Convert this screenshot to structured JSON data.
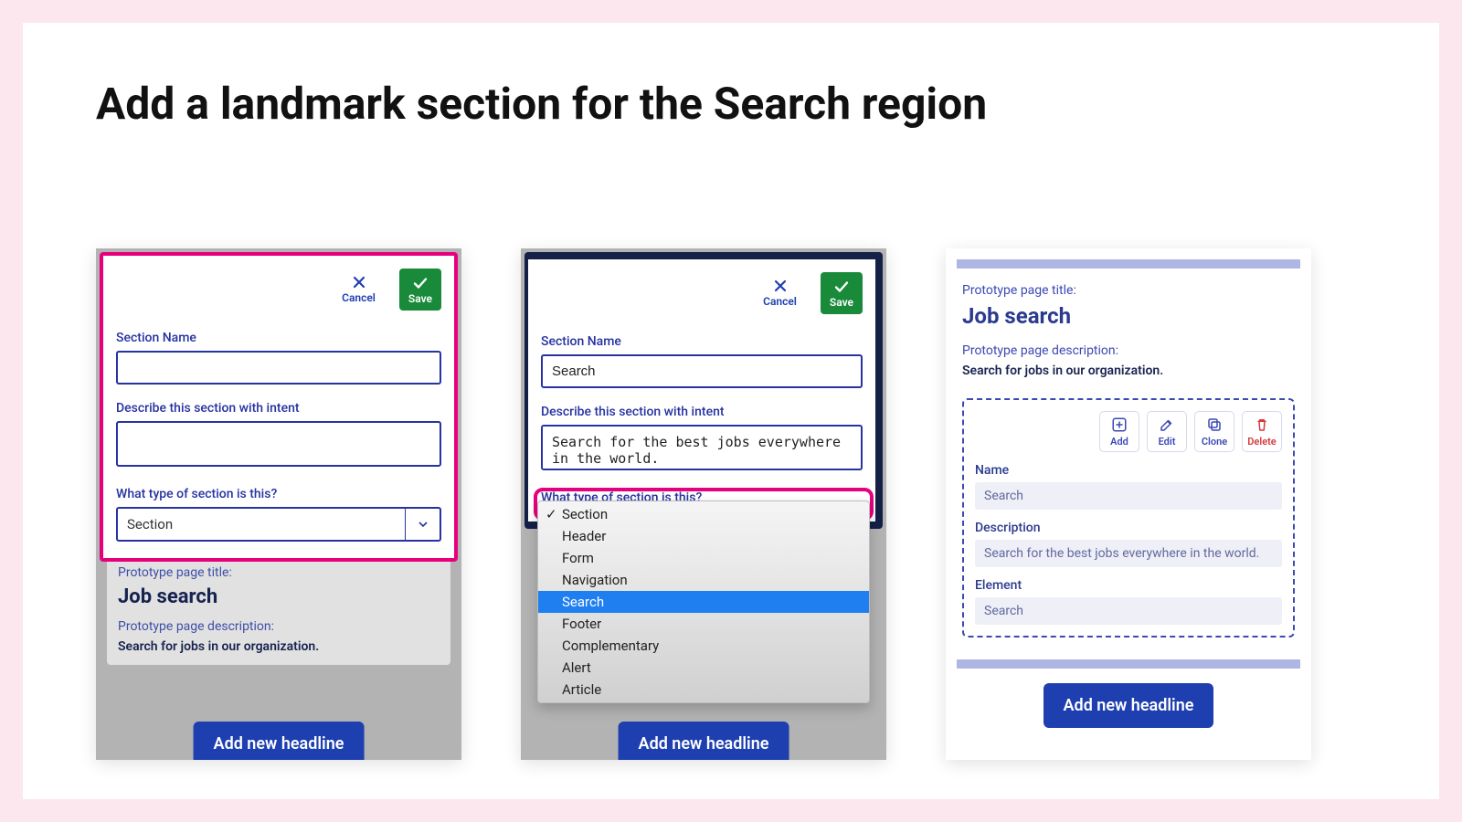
{
  "heading": "Add a landmark section for the Search region",
  "dialog": {
    "cancel_label": "Cancel",
    "save_label": "Save",
    "section_name_label": "Section Name",
    "describe_label": "Describe this section with intent",
    "type_label": "What type of section is this?"
  },
  "panel1": {
    "section_name_value": "",
    "describe_value": "",
    "type_value": "Section"
  },
  "panel2": {
    "section_name_value": "Search",
    "describe_value": "Search for the best jobs everywhere in the world.",
    "type_selected": "Section",
    "type_highlight": "Search",
    "options": [
      "Section",
      "Header",
      "Form",
      "Navigation",
      "Search",
      "Footer",
      "Complementary",
      "Alert",
      "Article"
    ]
  },
  "proto": {
    "title_label": "Prototype page title:",
    "title_value": "Job search",
    "desc_label": "Prototype page description:",
    "desc_value": "Search for jobs in our organization.",
    "add_headline_btn": "Add new headline"
  },
  "panel3": {
    "actions": {
      "add": "Add",
      "edit": "Edit",
      "clone": "Clone",
      "delete": "Delete"
    },
    "name_label": "Name",
    "name_value": "Search",
    "desc_label": "Description",
    "desc_value": "Search for the best jobs everywhere in the world.",
    "element_label": "Element",
    "element_value": "Search"
  }
}
